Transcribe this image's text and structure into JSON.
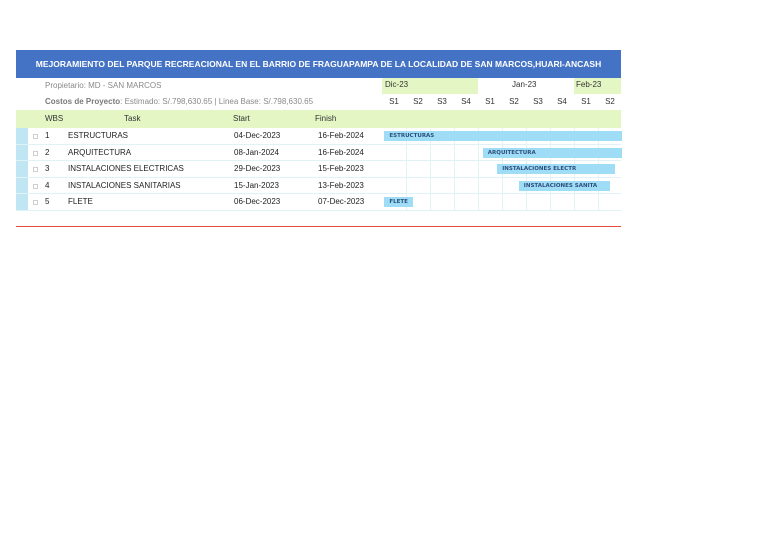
{
  "title": "MEJORAMIENTO DEL PARQUE RECREACIONAL EN EL BARRIO DE FRAGUAPAMPA DE LA LOCALIDAD DE SAN MARCOS,HUARI-ANCASH",
  "owner_line": "Propietario: MD - SAN MARCOS",
  "cost_label": "Costos de Proyecto",
  "cost_value": ": Estimado: S/.798,630.65 | Linea Base: S/.798,630.65",
  "months": [
    "Dic-23",
    "Jan-23",
    "Feb-23"
  ],
  "weeks": [
    "S1",
    "S2",
    "S3",
    "S4",
    "S1",
    "S2",
    "S3",
    "S4",
    "S1",
    "S2"
  ],
  "columns": {
    "wbs": "WBS",
    "task": "Task",
    "start": "Start",
    "finish": "Finish"
  },
  "tasks": [
    {
      "wbs": "1",
      "task": "ESTRUCTURAS",
      "start": "04-Dec-2023",
      "finish": "16-Feb-2024",
      "bar_label": "ESTRUCTURAS"
    },
    {
      "wbs": "2",
      "task": "ARQUITECTURA",
      "start": "08-Jan-2024",
      "finish": "16-Feb-2024",
      "bar_label": "ARQUITECTURA"
    },
    {
      "wbs": "3",
      "task": "INSTALACIONES ELECTRICAS",
      "start": "29-Dec-2023",
      "finish": "15-Feb-2023",
      "bar_label": "INSTALACIONES ELECTR"
    },
    {
      "wbs": "4",
      "task": "INSTALACIONES SANITARIAS",
      "start": "15-Jan-2023",
      "finish": "13-Feb-2023",
      "bar_label": "INSTALACIONES SANITA"
    },
    {
      "wbs": "5",
      "task": "FLETE",
      "start": "06-Dec-2023",
      "finish": "07-Dec-2023",
      "bar_label": "FLETE"
    }
  ],
  "colors": {
    "title_bg": "#4472c4",
    "header_bg": "#e3f6c4",
    "bar": "#9fdcf5",
    "footer_line": "#e64b3c"
  }
}
